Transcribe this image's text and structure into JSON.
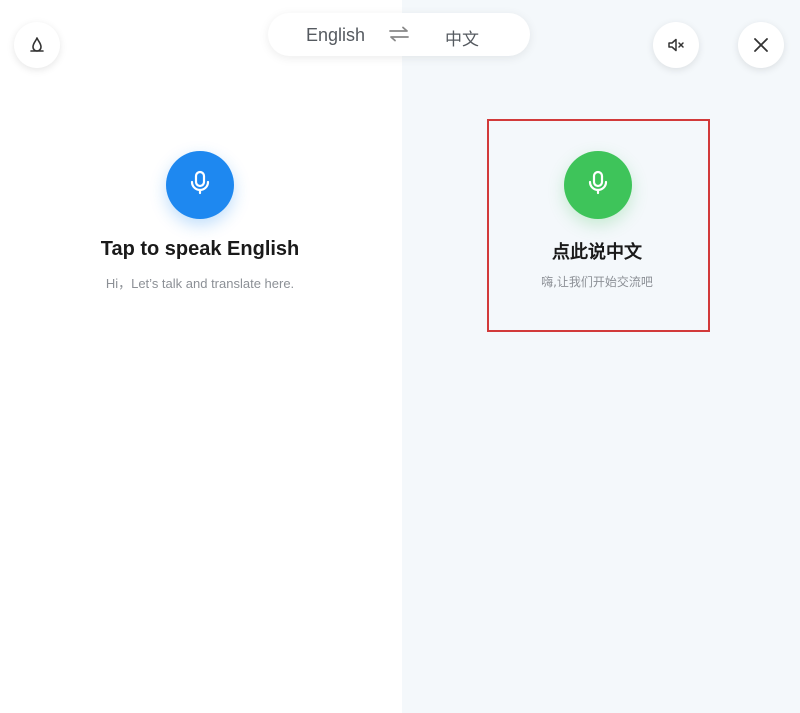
{
  "language_switch": {
    "source_language": "English",
    "target_language": "中文",
    "swap_icon": "swap-arrows-icon"
  },
  "toolbar": {
    "left_icon": "theme-icon",
    "mute_icon": "speaker-mute-icon",
    "close_icon": "close-icon"
  },
  "left_panel": {
    "mic_icon": "microphone-icon",
    "mic_color": "#1e88f0",
    "prompt": "Tap to speak English",
    "hint": "Hi，Let’s talk and translate here."
  },
  "right_panel": {
    "mic_icon": "microphone-icon",
    "mic_color": "#3ec45a",
    "prompt": "点此说中文",
    "hint": "嗨,让我们开始交流吧",
    "highlight_color": "#d23a3a"
  }
}
